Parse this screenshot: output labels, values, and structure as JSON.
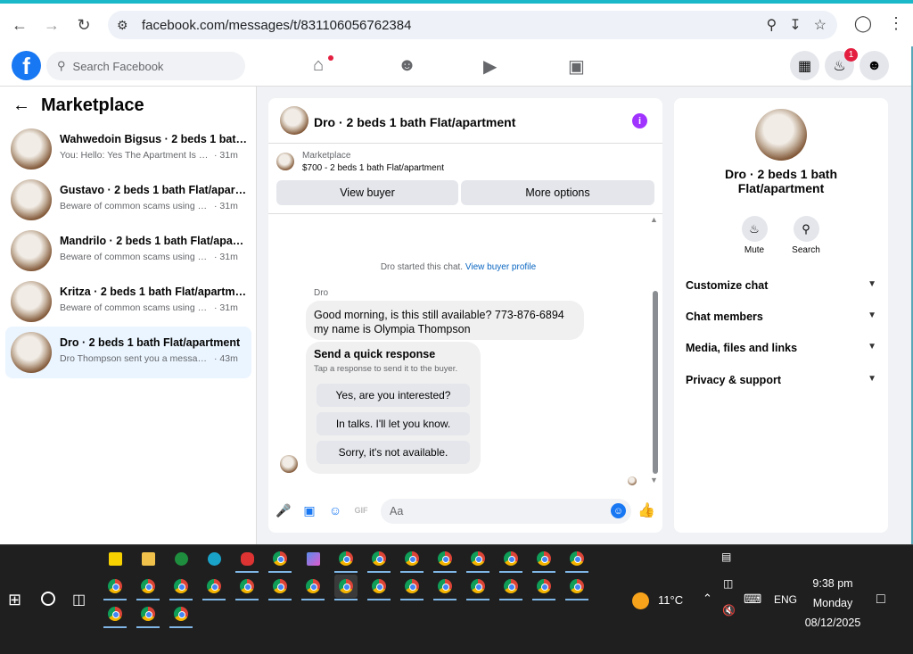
{
  "browser": {
    "url": "facebook.com/messages/t/831106056762384"
  },
  "header": {
    "search_placeholder": "Search Facebook",
    "notification_count": "1"
  },
  "sidebar": {
    "title": "Marketplace",
    "conversations": [
      {
        "name": "Wahwedoin Bigsus · 2 beds 1 bath ...",
        "snippet": "You: Hello: Yes The Apartment Is Still...",
        "time": "· 31m"
      },
      {
        "name": "Gustavo · 2 beds 1 bath Flat/apart...",
        "snippet": "Beware of common scams using pa...",
        "time": "· 31m"
      },
      {
        "name": "Mandrilo · 2 beds 1 bath Flat/apart...",
        "snippet": "Beware of common scams using pa...",
        "time": "· 31m"
      },
      {
        "name": "Kritza · 2 beds 1 bath Flat/apartment",
        "snippet": "Beware of common scams using pa...",
        "time": "· 31m"
      },
      {
        "name": "Dro · 2 beds 1 bath Flat/apartment",
        "snippet": "Dro Thompson sent you a message ...",
        "time": "· 43m"
      }
    ]
  },
  "chat": {
    "title": "Dro · 2 beds 1 bath Flat/apartment",
    "listing_label": "Marketplace",
    "listing_price": "$700 - 2 beds 1 bath Flat/apartment",
    "view_buyer": "View buyer",
    "more_options": "More options",
    "system_text": "Dro started this chat.",
    "system_link": "View buyer profile",
    "sender_name": "Dro",
    "message": "Good morning, is this still available? 773-876-6894 my name is Olympia Thompson",
    "quick_title": "Send a quick response",
    "quick_subtitle": "Tap a response to send it to the buyer.",
    "quick_responses": [
      "Yes, are you interested?",
      "In talks. I'll let you know.",
      "Sorry, it's not available."
    ],
    "composer_placeholder": "Aa"
  },
  "details": {
    "title": "Dro · 2 beds 1 bath Flat/apartment",
    "mute_label": "Mute",
    "search_label": "Search",
    "sections": [
      "Customize chat",
      "Chat members",
      "Media, files and links",
      "Privacy & support"
    ]
  },
  "taskbar": {
    "weather": "11°C",
    "language": "ENG",
    "time": "9:38 pm",
    "day": "Monday",
    "date": "08/12/2025"
  },
  "colors": {
    "fb_blue": "#1877f2",
    "active_conv": "#ebf5ff",
    "badge_red": "#e41e3f"
  }
}
